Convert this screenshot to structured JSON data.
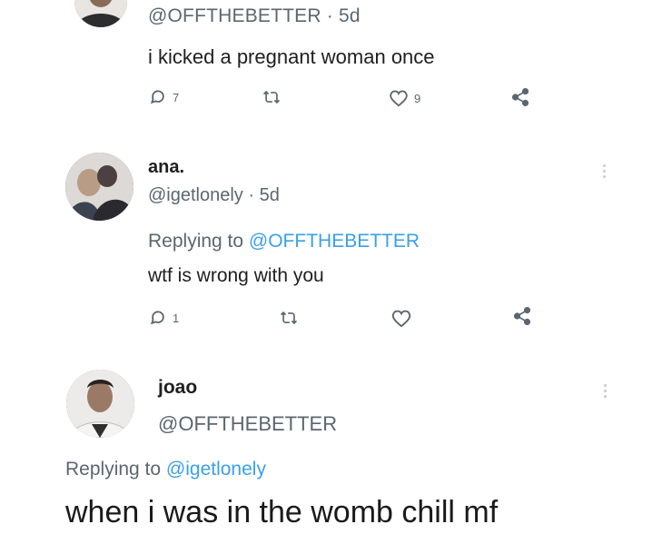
{
  "tweets": [
    {
      "handle": "@OFFTHEBETTER",
      "time": "· 5d",
      "text": "i kicked a pregnant woman once",
      "actions": {
        "reply_count": "7",
        "retweet_count": "",
        "like_count": "9"
      }
    },
    {
      "display_name": "ana.",
      "handle": "@igetlonely",
      "time": "· 5d",
      "replying_prefix": "Replying to",
      "replying_to": "@OFFTHEBETTER",
      "text": "wtf is wrong with you",
      "actions": {
        "reply_count": "1",
        "retweet_count": "",
        "like_count": ""
      }
    },
    {
      "display_name": "joao",
      "handle": "@OFFTHEBETTER",
      "replying_prefix": "Replying to",
      "replying_to": "@igetlonely",
      "text": "when i was in the womb chill mf"
    }
  ],
  "icons": {
    "reply": "reply-icon",
    "retweet": "retweet-icon",
    "like": "heart-icon",
    "share": "share-icon",
    "more": "more-vertical-icon"
  }
}
